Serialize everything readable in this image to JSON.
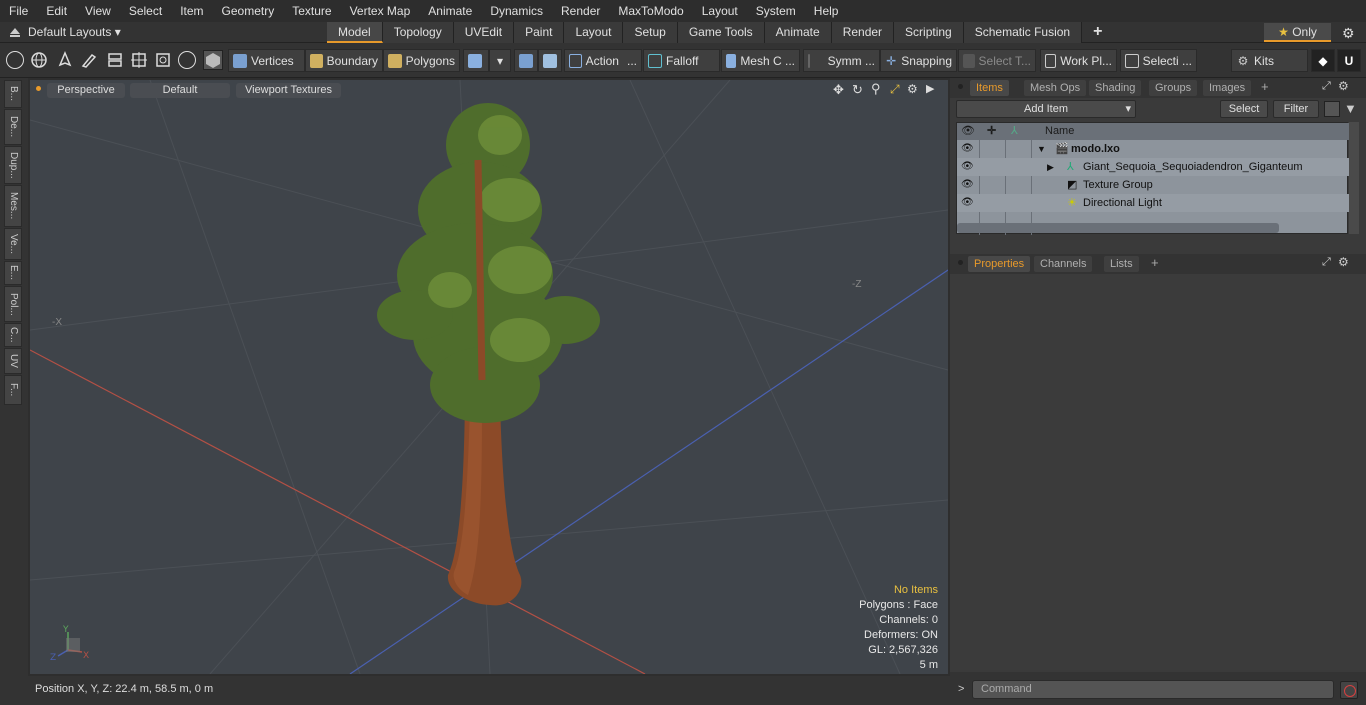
{
  "menu": [
    "File",
    "Edit",
    "View",
    "Select",
    "Item",
    "Geometry",
    "Texture",
    "Vertex Map",
    "Animate",
    "Dynamics",
    "Render",
    "MaxToModo",
    "Layout",
    "System",
    "Help"
  ],
  "layout_dropdown": "Default Layouts",
  "tabs": [
    "Model",
    "Topology",
    "UVEdit",
    "Paint",
    "Layout",
    "Setup",
    "Game Tools",
    "Animate",
    "Render",
    "Scripting",
    "Schematic Fusion"
  ],
  "only_label": "Only",
  "toolbar": {
    "vertices": "Vertices",
    "boundary": "Boundary",
    "polygons": "Polygons",
    "action": "Action",
    "falloff": "Falloff",
    "mesh": "Mesh C ...",
    "symm": "Symm ...",
    "snapping": "Snapping",
    "select_t": "Select T...",
    "work_pl": "Work Pl...",
    "selecti": "Selecti ...",
    "kits": "Kits"
  },
  "left_tabs": [
    "B...",
    "De...",
    "Dup...",
    "Mes...",
    "Ve...",
    "E...",
    "Pol...",
    "C...",
    "UV",
    "F..."
  ],
  "viewport": {
    "view_mode": "Perspective",
    "shading": "Default",
    "textures": "Viewport Textures",
    "stats": {
      "no_items": "No Items",
      "polygons": "Polygons : Face",
      "channels": "Channels: 0",
      "deformers": "Deformers: ON",
      "gl": "GL: 2,567,326",
      "scale": "5 m"
    },
    "axis_z": "-Z",
    "axis_x": "-X"
  },
  "status": {
    "position": "Position X, Y, Z:   22.4 m, 58.5 m, 0 m"
  },
  "items_panel": {
    "tabs": [
      "Items",
      "Mesh Ops",
      "Shading",
      "Groups",
      "Images"
    ],
    "add_item": "Add Item",
    "select": "Select",
    "filter": "Filter",
    "name_col": "Name",
    "rows": [
      "modo.lxo",
      "Giant_Sequoia_Sequoiadendron_Giganteum",
      "Texture Group",
      "Directional Light"
    ]
  },
  "props_panel": {
    "tabs": [
      "Properties",
      "Channels",
      "Lists"
    ]
  },
  "command": {
    "placeholder": "Command"
  },
  "colors": {
    "accent": "#e89a2b",
    "viewport_bg": "#3f444a",
    "foliage": "#4f6d2c",
    "trunk": "#8c4a28"
  }
}
